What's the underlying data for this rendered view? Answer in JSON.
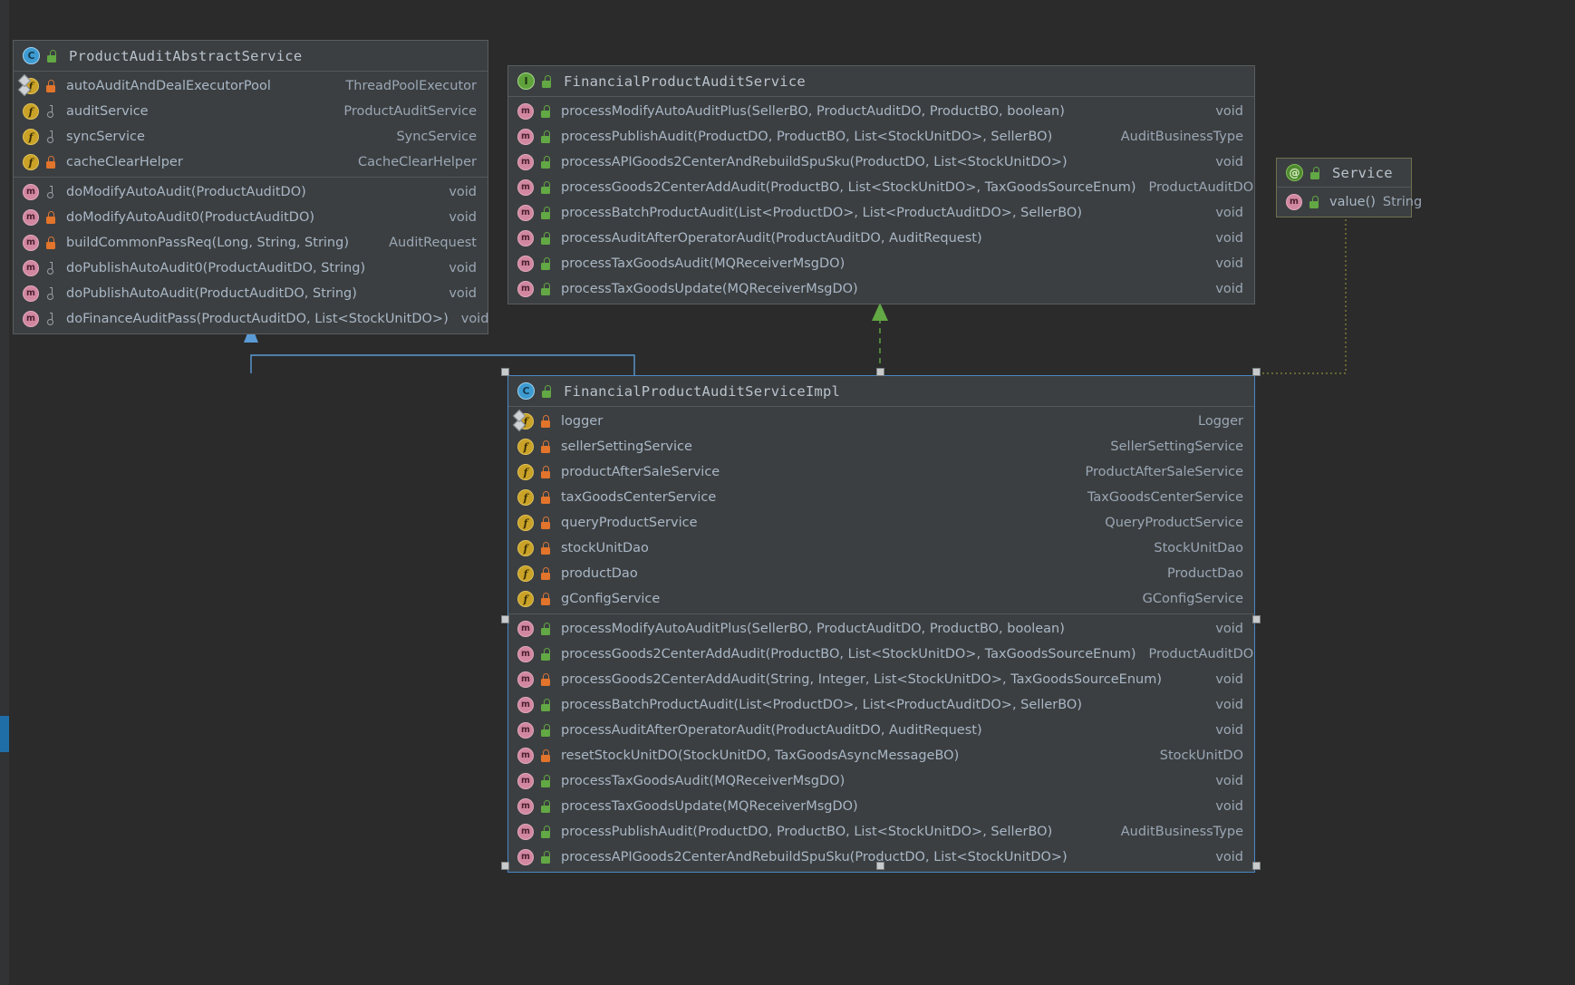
{
  "diagram": {
    "kind": "uml-class-diagram",
    "background": "#2b2b2b",
    "node_bg": "#3c3f41",
    "selection_color": "#4a88c7",
    "inherit_link_color": "#5b9bd5",
    "realize_link_color": "#62a844",
    "anno_link_color": "#8a8b3a"
  },
  "abstract_service": {
    "title": "ProductAuditAbstractService",
    "stereotype_icon": "class-icon",
    "visibility_icon": "unlock-public-icon",
    "fields": [
      {
        "icon": "field-static-icon",
        "vis": "priv",
        "vis_icon": "lock-private-icon",
        "name": "autoAuditAndDealExecutorPool",
        "type": "ThreadPoolExecutor"
      },
      {
        "icon": "field-icon",
        "vis": "pkg",
        "vis_icon": "package-private-icon",
        "name": "auditService",
        "type": "ProductAuditService"
      },
      {
        "icon": "field-icon",
        "vis": "pkg",
        "vis_icon": "package-private-icon",
        "name": "syncService",
        "type": "SyncService"
      },
      {
        "icon": "field-icon",
        "vis": "priv",
        "vis_icon": "lock-private-icon",
        "name": "cacheClearHelper",
        "type": "CacheClearHelper"
      }
    ],
    "methods": [
      {
        "icon": "method-icon",
        "vis": "pkg",
        "vis_icon": "package-private-icon",
        "name": "doModifyAutoAudit(ProductAuditDO)",
        "type": "void"
      },
      {
        "icon": "method-icon",
        "vis": "priv",
        "vis_icon": "lock-private-icon",
        "name": "doModifyAutoAudit0(ProductAuditDO)",
        "type": "void"
      },
      {
        "icon": "method-icon",
        "vis": "priv",
        "vis_icon": "lock-private-icon",
        "name": "buildCommonPassReq(Long, String, String)",
        "type": "AuditRequest"
      },
      {
        "icon": "method-icon",
        "vis": "pkg",
        "vis_icon": "package-private-icon",
        "name": "doPublishAutoAudit0(ProductAuditDO, String)",
        "type": "void"
      },
      {
        "icon": "method-icon",
        "vis": "pkg",
        "vis_icon": "package-private-icon",
        "name": "doPublishAutoAudit(ProductAuditDO, String)",
        "type": "void"
      },
      {
        "icon": "method-icon",
        "vis": "pkg",
        "vis_icon": "package-private-icon",
        "name": "doFinanceAuditPass(ProductAuditDO, List<StockUnitDO>)",
        "type": "void"
      }
    ]
  },
  "audit_service_interface": {
    "title": "FinancialProductAuditService",
    "stereotype_icon": "interface-icon",
    "visibility_icon": "unlock-public-icon",
    "methods": [
      {
        "icon": "method-icon",
        "vis": "pub",
        "vis_icon": "unlock-public-icon",
        "name": "processModifyAutoAuditPlus(SellerBO, ProductAuditDO, ProductBO, boolean)",
        "type": "void"
      },
      {
        "icon": "method-icon",
        "vis": "pub",
        "vis_icon": "unlock-public-icon",
        "name": "processPublishAudit(ProductDO, ProductBO, List<StockUnitDO>, SellerBO)",
        "type": "AuditBusinessType"
      },
      {
        "icon": "method-icon",
        "vis": "pub",
        "vis_icon": "unlock-public-icon",
        "name": "processAPIGoods2CenterAndRebuildSpuSku(ProductDO, List<StockUnitDO>)",
        "type": "void"
      },
      {
        "icon": "method-icon",
        "vis": "pub",
        "vis_icon": "unlock-public-icon",
        "name": "processGoods2CenterAddAudit(ProductBO, List<StockUnitDO>, TaxGoodsSourceEnum)",
        "type": "ProductAuditDO"
      },
      {
        "icon": "method-icon",
        "vis": "pub",
        "vis_icon": "unlock-public-icon",
        "name": "processBatchProductAudit(List<ProductDO>, List<ProductAuditDO>, SellerBO)",
        "type": "void"
      },
      {
        "icon": "method-icon",
        "vis": "pub",
        "vis_icon": "unlock-public-icon",
        "name": "processAuditAfterOperatorAudit(ProductAuditDO, AuditRequest)",
        "type": "void"
      },
      {
        "icon": "method-icon",
        "vis": "pub",
        "vis_icon": "unlock-public-icon",
        "name": "processTaxGoodsAudit(MQReceiverMsgDO)",
        "type": "void"
      },
      {
        "icon": "method-icon",
        "vis": "pub",
        "vis_icon": "unlock-public-icon",
        "name": "processTaxGoodsUpdate(MQReceiverMsgDO)",
        "type": "void"
      }
    ]
  },
  "service_annotation": {
    "title": "Service",
    "stereotype_icon": "annotation-icon",
    "visibility_icon": "unlock-public-icon",
    "members": [
      {
        "icon": "method-icon",
        "vis": "pub",
        "vis_icon": "unlock-public-icon",
        "name": "value()",
        "type": "String"
      }
    ]
  },
  "audit_service_impl": {
    "title": "FinancialProductAuditServiceImpl",
    "stereotype_icon": "class-icon",
    "visibility_icon": "unlock-public-icon",
    "selected": true,
    "fields": [
      {
        "icon": "field-static-icon",
        "vis": "priv",
        "vis_icon": "lock-private-icon",
        "name": "logger",
        "type": "Logger"
      },
      {
        "icon": "field-icon",
        "vis": "priv",
        "vis_icon": "lock-private-icon",
        "name": "sellerSettingService",
        "type": "SellerSettingService"
      },
      {
        "icon": "field-icon",
        "vis": "priv",
        "vis_icon": "lock-private-icon",
        "name": "productAfterSaleService",
        "type": "ProductAfterSaleService"
      },
      {
        "icon": "field-icon",
        "vis": "priv",
        "vis_icon": "lock-private-icon",
        "name": "taxGoodsCenterService",
        "type": "TaxGoodsCenterService"
      },
      {
        "icon": "field-icon",
        "vis": "priv",
        "vis_icon": "lock-private-icon",
        "name": "queryProductService",
        "type": "QueryProductService"
      },
      {
        "icon": "field-icon",
        "vis": "priv",
        "vis_icon": "lock-private-icon",
        "name": "stockUnitDao",
        "type": "StockUnitDao"
      },
      {
        "icon": "field-icon",
        "vis": "priv",
        "vis_icon": "lock-private-icon",
        "name": "productDao",
        "type": "ProductDao"
      },
      {
        "icon": "field-icon",
        "vis": "priv",
        "vis_icon": "lock-private-icon",
        "name": "gConfigService",
        "type": "GConfigService"
      }
    ],
    "methods": [
      {
        "icon": "method-icon",
        "vis": "pub",
        "vis_icon": "unlock-public-icon",
        "name": "processModifyAutoAuditPlus(SellerBO, ProductAuditDO, ProductBO, boolean)",
        "type": "void"
      },
      {
        "icon": "method-icon",
        "vis": "pub",
        "vis_icon": "unlock-public-icon",
        "name": "processGoods2CenterAddAudit(ProductBO, List<StockUnitDO>, TaxGoodsSourceEnum)",
        "type": "ProductAuditDO"
      },
      {
        "icon": "method-icon",
        "vis": "priv",
        "vis_icon": "lock-private-icon",
        "name": "processGoods2CenterAddAudit(String, Integer, List<StockUnitDO>, TaxGoodsSourceEnum)",
        "type": "void"
      },
      {
        "icon": "method-icon",
        "vis": "pub",
        "vis_icon": "unlock-public-icon",
        "name": "processBatchProductAudit(List<ProductDO>, List<ProductAuditDO>, SellerBO)",
        "type": "void"
      },
      {
        "icon": "method-icon",
        "vis": "pub",
        "vis_icon": "unlock-public-icon",
        "name": "processAuditAfterOperatorAudit(ProductAuditDO, AuditRequest)",
        "type": "void"
      },
      {
        "icon": "method-icon",
        "vis": "priv",
        "vis_icon": "lock-private-icon",
        "name": "resetStockUnitDO(StockUnitDO, TaxGoodsAsyncMessageBO)",
        "type": "StockUnitDO"
      },
      {
        "icon": "method-icon",
        "vis": "pub",
        "vis_icon": "unlock-public-icon",
        "name": "processTaxGoodsAudit(MQReceiverMsgDO)",
        "type": "void"
      },
      {
        "icon": "method-icon",
        "vis": "pub",
        "vis_icon": "unlock-public-icon",
        "name": "processTaxGoodsUpdate(MQReceiverMsgDO)",
        "type": "void"
      },
      {
        "icon": "method-icon",
        "vis": "pub",
        "vis_icon": "unlock-public-icon",
        "name": "processPublishAudit(ProductDO, ProductBO, List<StockUnitDO>, SellerBO)",
        "type": "AuditBusinessType"
      },
      {
        "icon": "method-icon",
        "vis": "pub",
        "vis_icon": "unlock-public-icon",
        "name": "processAPIGoods2CenterAndRebuildSpuSku(ProductDO, List<StockUnitDO>)",
        "type": "void"
      }
    ]
  }
}
